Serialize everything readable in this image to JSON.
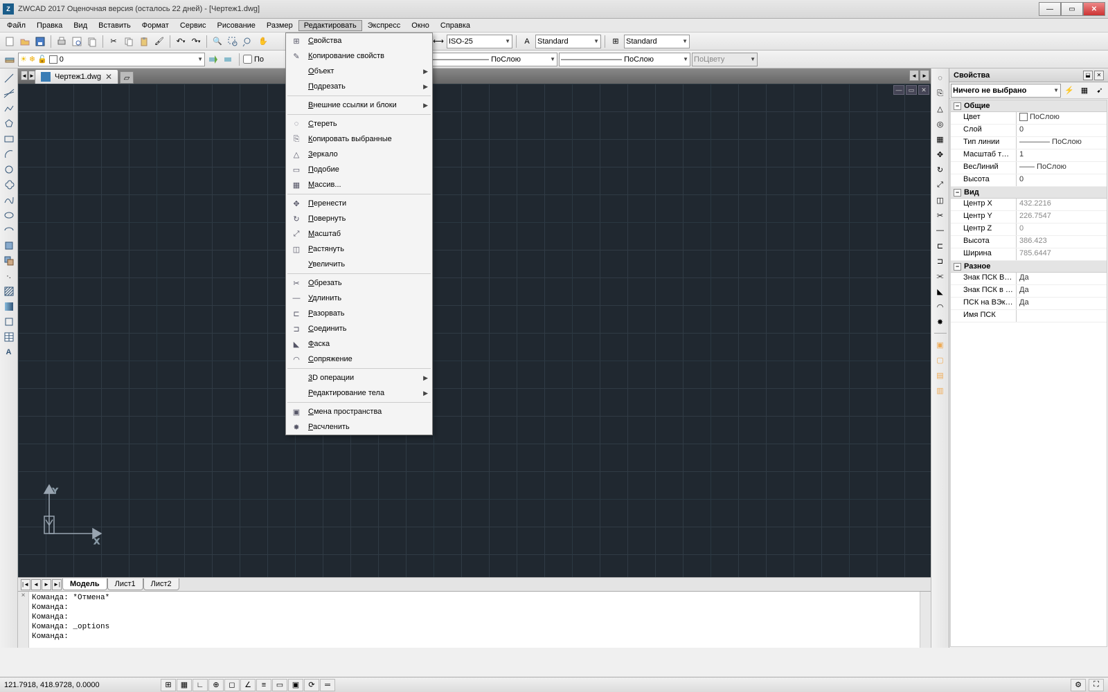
{
  "title": "ZWCAD 2017 Оценочная версия (осталось 22 дней) - [Чертеж1.dwg]",
  "menubar": [
    "Файл",
    "Правка",
    "Вид",
    "Вставить",
    "Формат",
    "Сервис",
    "Рисование",
    "Размер",
    "Редактировать",
    "Экспресс",
    "Окно",
    "Справка"
  ],
  "activeMenu": 8,
  "toolbar2": {
    "dimstyle": "ISO-25",
    "textstyle": "Standard",
    "tablestyle": "Standard"
  },
  "layerrow": {
    "layer": "0",
    "checkbox": "По",
    "lt1": "ПоСлою",
    "lt2": "ПоСлою",
    "bycolor": "ПоЦвету"
  },
  "doctab": {
    "name": "Чертеж1.dwg"
  },
  "dropdown": [
    {
      "t": "Свойства",
      "i": "⊞"
    },
    {
      "t": "Копирование свойств",
      "i": "✎"
    },
    {
      "t": "Объект",
      "sub": true
    },
    {
      "t": "Подрезать",
      "sub": true
    },
    {
      "sep": true
    },
    {
      "t": "Внешние ссылки и блоки",
      "sub": true
    },
    {
      "sep": true
    },
    {
      "t": "Стереть",
      "i": "◌"
    },
    {
      "t": "Копировать выбранные",
      "i": "⎘"
    },
    {
      "t": "Зеркало",
      "i": "△"
    },
    {
      "t": "Подобие",
      "i": "▭"
    },
    {
      "t": "Массив...",
      "i": "▦"
    },
    {
      "sep": true
    },
    {
      "t": "Перенести",
      "i": "✥"
    },
    {
      "t": "Повернуть",
      "i": "↻"
    },
    {
      "t": "Масштаб",
      "i": "⤢"
    },
    {
      "t": "Растянуть",
      "i": "◫"
    },
    {
      "t": "Увеличить"
    },
    {
      "sep": true
    },
    {
      "t": "Обрезать",
      "i": "✂"
    },
    {
      "t": "Удлинить",
      "i": "—"
    },
    {
      "t": "Разорвать",
      "i": "⊏"
    },
    {
      "t": "Соединить",
      "i": "⊐"
    },
    {
      "t": "Фаска",
      "i": "◣"
    },
    {
      "t": "Сопряжение",
      "i": "◠"
    },
    {
      "sep": true
    },
    {
      "t": "3D операции",
      "sub": true
    },
    {
      "t": "Редактирование тела",
      "sub": true
    },
    {
      "sep": true
    },
    {
      "t": "Смена пространства",
      "i": "▣"
    },
    {
      "t": "Расчленить",
      "i": "✸"
    }
  ],
  "modeltabs": [
    "Модель",
    "Лист1",
    "Лист2"
  ],
  "cmdlines": "Команда: *Отмена*\nКоманда:\nКоманда:\nКоманда: _options\nКоманда:",
  "props": {
    "title": "Свойства",
    "selection": "Ничего не выбрано",
    "groups": [
      {
        "name": "Общие",
        "rows": [
          {
            "k": "Цвет",
            "v": "ПоСлою",
            "sw": "#fff"
          },
          {
            "k": "Слой",
            "v": "0"
          },
          {
            "k": "Тип линии",
            "v": "———— ПоСлою"
          },
          {
            "k": "Масштаб типа л...",
            "v": "1"
          },
          {
            "k": "ВесЛиний",
            "v": "—— ПоСлою"
          },
          {
            "k": "Высота",
            "v": "0"
          }
        ]
      },
      {
        "name": "Вид",
        "rows": [
          {
            "k": "Центр X",
            "v": "432.2216",
            "ro": true
          },
          {
            "k": "Центр Y",
            "v": "226.7547",
            "ro": true
          },
          {
            "k": "Центр Z",
            "v": "0",
            "ro": true
          },
          {
            "k": "Высота",
            "v": "386.423",
            "ro": true
          },
          {
            "k": "Ширина",
            "v": "785.6447",
            "ro": true
          }
        ]
      },
      {
        "name": "Разное",
        "rows": [
          {
            "k": "Знак ПСК ВКЛ",
            "v": "Да"
          },
          {
            "k": "Знак ПСК в нач. ...",
            "v": "Да"
          },
          {
            "k": "ПСК на ВЭкран",
            "v": "Да"
          },
          {
            "k": "Имя ПСК",
            "v": ""
          }
        ]
      }
    ]
  },
  "status": {
    "coords": "121.7918, 418.9728, 0.0000"
  }
}
